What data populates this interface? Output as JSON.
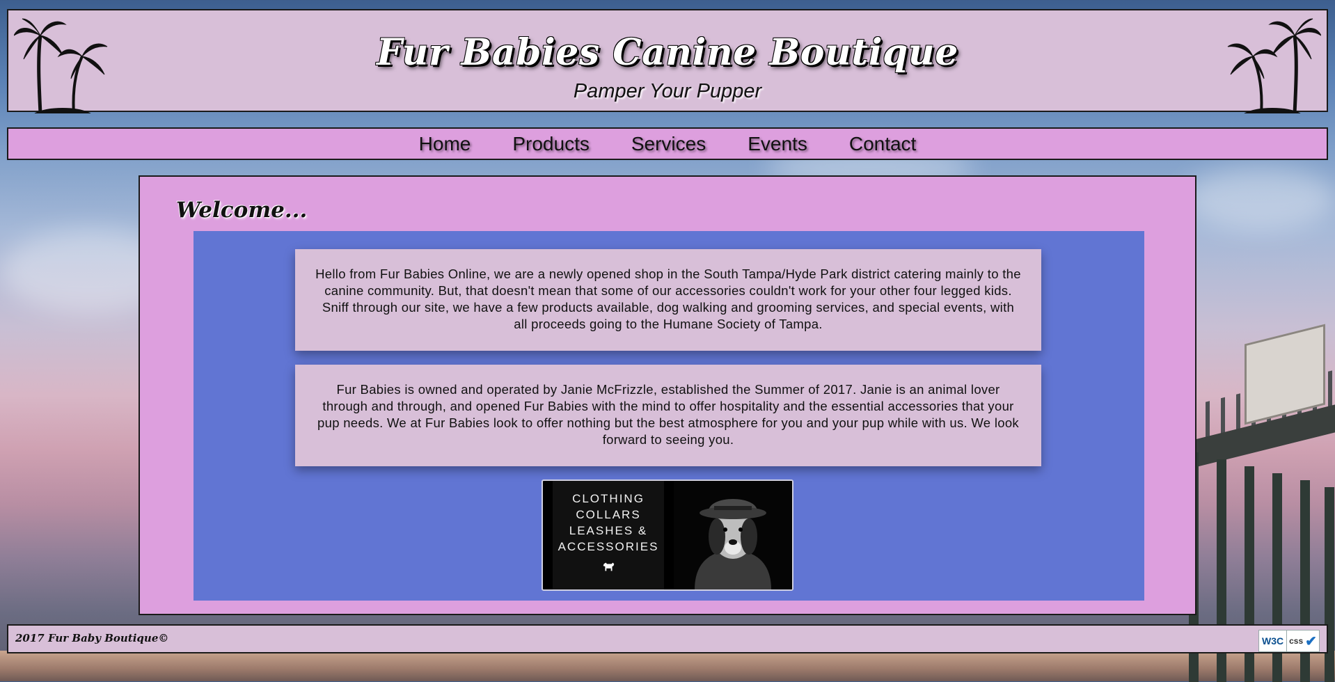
{
  "header": {
    "title": "Fur Babies Canine Boutique",
    "tagline": "Pamper Your Pupper"
  },
  "nav": {
    "items": [
      "Home",
      "Products",
      "Services",
      "Events",
      "Contact"
    ]
  },
  "main": {
    "heading": "Welcome...",
    "intro": "Hello from Fur Babies Online, we are a newly opened shop in the South Tampa/Hyde Park district catering mainly to the canine community. But, that doesn't mean that some of our accessories couldn't work for your other four legged kids. Sniff through our site, we have a few products available, dog walking and grooming services, and special events, with all proceeds going to the Humane Society of Tampa.",
    "owner": "Fur Babies is owned and operated by Janie McFrizzle, established the Summer of 2017. Janie is an animal lover through and through, and opened Fur Babies with the mind to offer hospitality and the essential accessories that your pup needs. We at Fur Babies look to offer nothing but the best atmosphere for you and your pup while with us. We look forward to seeing you.",
    "promo": {
      "lines": [
        "CLOTHING",
        "COLLARS",
        "LEASHES &",
        "ACCESSORIES"
      ]
    }
  },
  "footer": {
    "copyright": "2017 Fur Baby Boutique©",
    "badge_w3c": "W3C",
    "badge_css": "css"
  },
  "colors": {
    "header_bg": "#d8bfd8",
    "nav_bg": "#dd9fde",
    "content_bg": "#6175d3"
  }
}
